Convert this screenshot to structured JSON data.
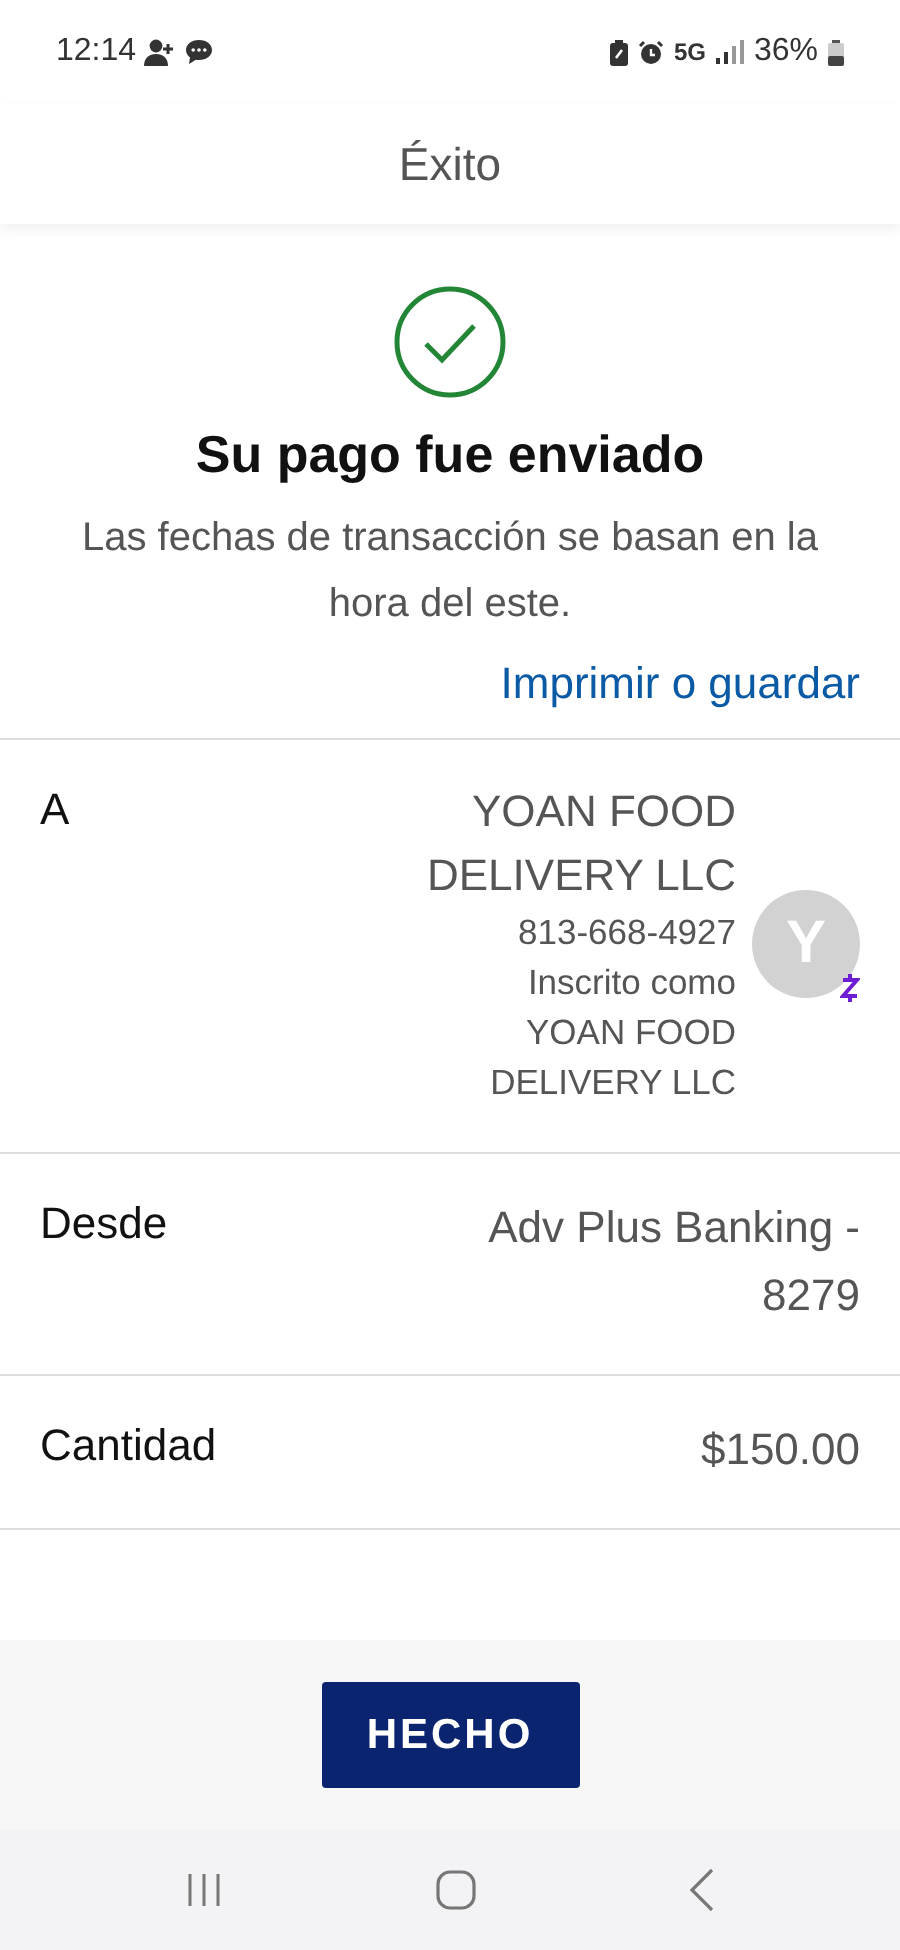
{
  "status_bar": {
    "time": "12:14",
    "network": "5G",
    "battery": "36%"
  },
  "header": {
    "title": "Éxito"
  },
  "confirmation": {
    "title": "Su pago fue enviado",
    "subtitle": "Las fechas de transacción se basan en la hora del este.",
    "link": "Imprimir o guardar"
  },
  "details": [
    {
      "kind": "recipient",
      "label": "A",
      "name": "YOAN FOOD DELIVERY LLC",
      "phone": "813-668-4927",
      "enrolled_label": "Inscrito como",
      "enrolled_name": "YOAN FOOD DELIVERY LLC",
      "avatar": "Y"
    },
    {
      "kind": "plain",
      "label": "Desde",
      "value": "Adv Plus Banking - 8279"
    },
    {
      "kind": "plain",
      "label": "Cantidad",
      "value": "$150.00"
    }
  ],
  "button": "HECHO"
}
